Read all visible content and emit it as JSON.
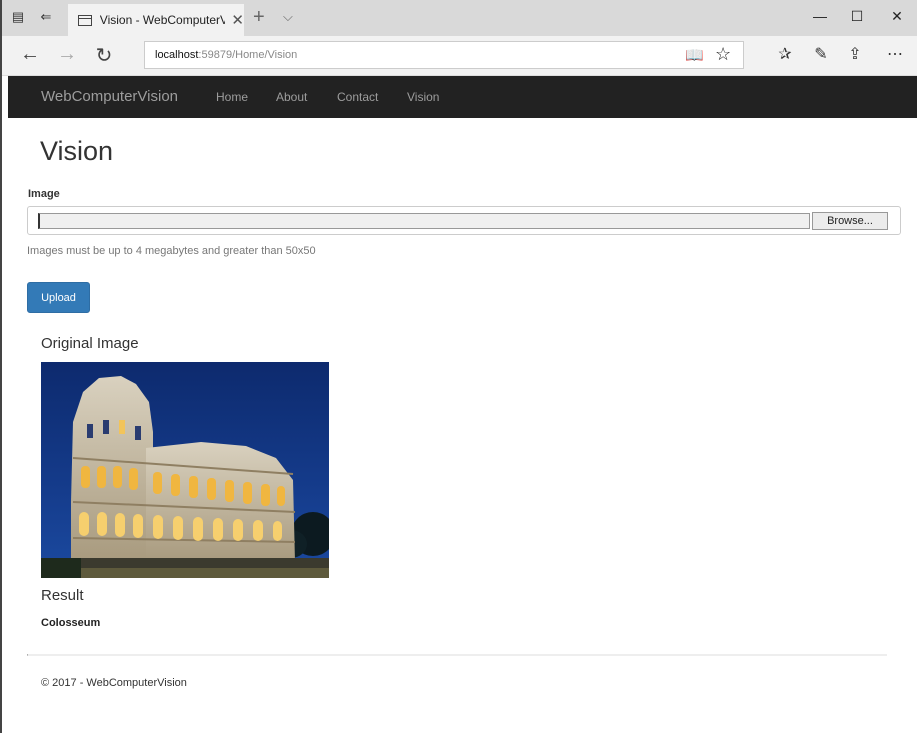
{
  "browser": {
    "tab_title": "Vision - WebComputerV",
    "tab_close_glyph": "✕",
    "new_tab_glyph": "+",
    "tab_list_glyph": "⌵",
    "url_host": "localhost",
    "url_rest": ":59879/Home/Vision",
    "window_controls": {
      "minimize": "—",
      "maximize": "☐",
      "close": "✕"
    }
  },
  "icons": {
    "tab_preview": "tab-preview-icon",
    "set_aside": "set-aside-tabs-icon",
    "page": "page-icon",
    "back": "back-arrow-icon",
    "forward": "forward-arrow-icon",
    "refresh": "refresh-icon",
    "reading_view": "reading-view-icon",
    "favorite": "star-icon",
    "favorites_hub": "favorites-hub-icon",
    "notes": "pen-icon",
    "share": "share-icon",
    "more": "more-icon"
  },
  "navbar": {
    "brand": "WebComputerVision",
    "links": [
      "Home",
      "About",
      "Contact",
      "Vision"
    ]
  },
  "page": {
    "title": "Vision",
    "image_label": "Image",
    "browse_label": "Browse...",
    "help_text": "Images must be up to 4 megabytes and greater than 50x50",
    "upload_label": "Upload",
    "original_heading": "Original Image",
    "result_heading": "Result",
    "result_value": "Colosseum"
  },
  "footer": {
    "text": "© 2017 - WebComputerVision"
  },
  "colors": {
    "navbar_bg": "#222222",
    "navbar_text": "#9d9d9d",
    "primary_button": "#337ab7",
    "night_sky": "#13307a"
  }
}
